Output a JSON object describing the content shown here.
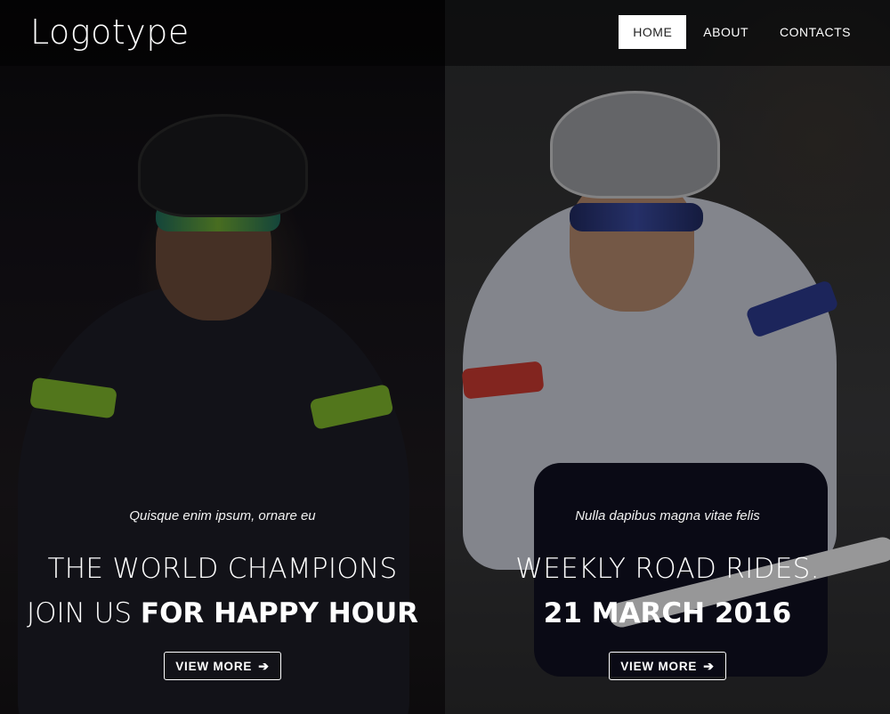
{
  "header": {
    "logo": "Logotype",
    "nav": [
      {
        "label": "HOME",
        "active": true
      },
      {
        "label": "ABOUT",
        "active": false
      },
      {
        "label": "CONTACTS",
        "active": false
      }
    ]
  },
  "slides": [
    {
      "subtitle": "Quisque enim ipsum, ornare eu",
      "line1": "THE WORLD CHAMPIONS",
      "line2_light": "JOIN US ",
      "line2_bold": "FOR HAPPY HOUR",
      "button_label": "VIEW MORE",
      "button_icon": "arrow-right-icon"
    },
    {
      "subtitle": "Nulla dapibus magna vitae felis",
      "line1": "WEEKLY ROAD RIDES.",
      "line2_bold": "21 MARCH 2016",
      "button_label": "VIEW MORE",
      "button_icon": "arrow-right-icon"
    }
  ],
  "colors": {
    "active_nav_bg": "#ffffff",
    "active_nav_text": "#222222",
    "text": "#ffffff"
  }
}
